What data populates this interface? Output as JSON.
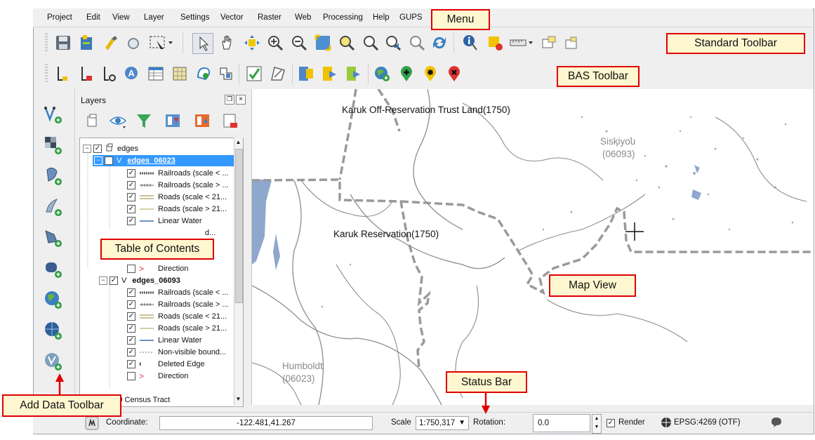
{
  "menu": {
    "items": [
      "Project",
      "Edit",
      "View",
      "Layer",
      "Settings",
      "Vector",
      "Raster",
      "Web",
      "Processing",
      "Help",
      "GUPS"
    ]
  },
  "callouts": {
    "menu": "Menu",
    "standard_toolbar": "Standard Toolbar",
    "bas_toolbar": "BAS Toolbar",
    "table_of_contents": "Table of Contents",
    "map_view": "Map View",
    "status_bar": "Status Bar",
    "add_data_toolbar": "Add Data Toolbar"
  },
  "layers_panel": {
    "title": "Layers",
    "group": "edges",
    "layer1": {
      "name": "edges_06023",
      "items": [
        "Railroads (scale < ...",
        "Railroads (scale > ...",
        "Roads (scale < 21...",
        "Roads (scale > 21...",
        "Linear Water",
        "d..."
      ]
    },
    "direction_a": "Direction",
    "layer2": {
      "name": "edges_06093",
      "items": [
        "Railroads (scale < ...",
        "Railroads (scale > ...",
        "Roads (scale < 21...",
        "Roads (scale > 21...",
        "Linear Water",
        "Non-visible bound...",
        "Deleted Edge"
      ]
    },
    "direction_b": "Direction",
    "last_layer": "2010  Census Tract"
  },
  "map": {
    "labels": {
      "off_reservation": "Karuk Off-Reservation Trust Land(1750)",
      "reservation": "Karuk Reservation(1750)",
      "siskiyou_name": "Siskiyou",
      "siskiyou_code": "(06093)",
      "humboldt_name": "Humboldt",
      "humboldt_code": "(06023)"
    },
    "colors": {
      "boundary": "#9a9a9a",
      "water": "#8ea7cc",
      "roads": "#8c8c8c"
    }
  },
  "status_bar": {
    "coordinate_label": "Coordinate:",
    "coordinate_value": "-122.481,41.267",
    "scale_label": "Scale",
    "scale_value": "1:750,317",
    "rotation_label": "Rotation:",
    "rotation_value": "0.0",
    "render_label": "Render",
    "crs": "EPSG:4269 (OTF)"
  },
  "colors": {
    "callout_border": "#e00000",
    "callout_fill": "#fff7d0",
    "selection": "#3399ff"
  }
}
